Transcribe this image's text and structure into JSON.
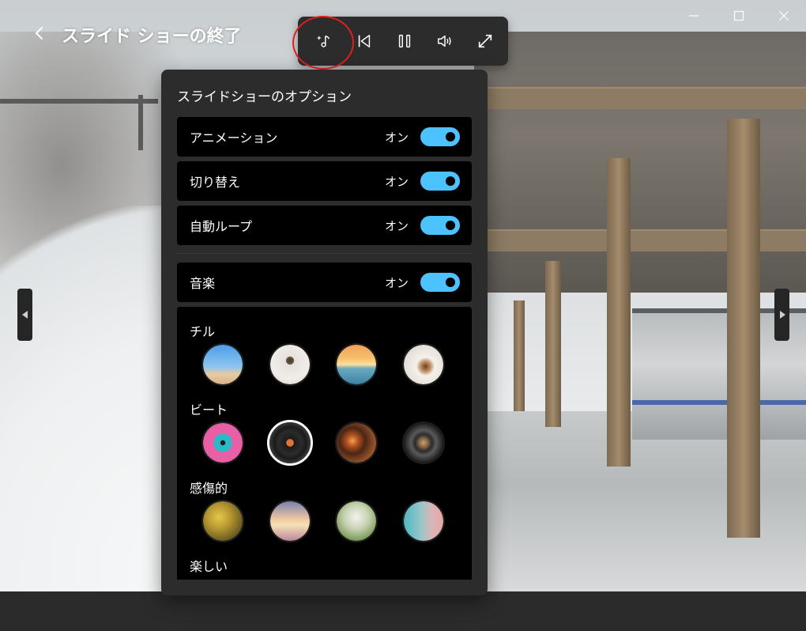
{
  "window": {
    "title": "スライド ショーの終了",
    "controls": [
      "minimize-icon",
      "maximize-icon",
      "close-icon"
    ]
  },
  "toolbar": {
    "buttons": [
      {
        "icon": "music-sparkle-icon",
        "highlighted": true
      },
      {
        "icon": "skip-back-icon"
      },
      {
        "icon": "pause-icon"
      },
      {
        "icon": "volume-icon"
      },
      {
        "icon": "expand-icon"
      }
    ]
  },
  "highlight_color": "#e01e1e",
  "panel": {
    "title": "スライドショーのオプション",
    "options": [
      {
        "label": "アニメーション",
        "state": "オン",
        "on": true
      },
      {
        "label": "切り替え",
        "state": "オン",
        "on": true
      },
      {
        "label": "自動ループ",
        "state": "オン",
        "on": true
      }
    ],
    "music": {
      "label": "音楽",
      "state": "オン",
      "on": true
    },
    "categories": [
      {
        "name": "チル",
        "thumbs": [
          "beach-sky",
          "palm-tree",
          "sunset-sea",
          "coffee-cup"
        ]
      },
      {
        "name": "ビート",
        "thumbs": [
          "cassette-tape",
          "vinyl-record",
          "turntable",
          "speaker"
        ],
        "selected": 1
      },
      {
        "name": "感傷的",
        "thumbs": [
          "yellow-flowers",
          "sunset-clouds",
          "soft-green",
          "pastel-gradient"
        ]
      },
      {
        "name": "楽しい",
        "thumbs": []
      }
    ]
  },
  "colors": {
    "accent": "#4cc2ff",
    "panel_bg": "#2c2c2c",
    "row_bg": "#000000"
  }
}
